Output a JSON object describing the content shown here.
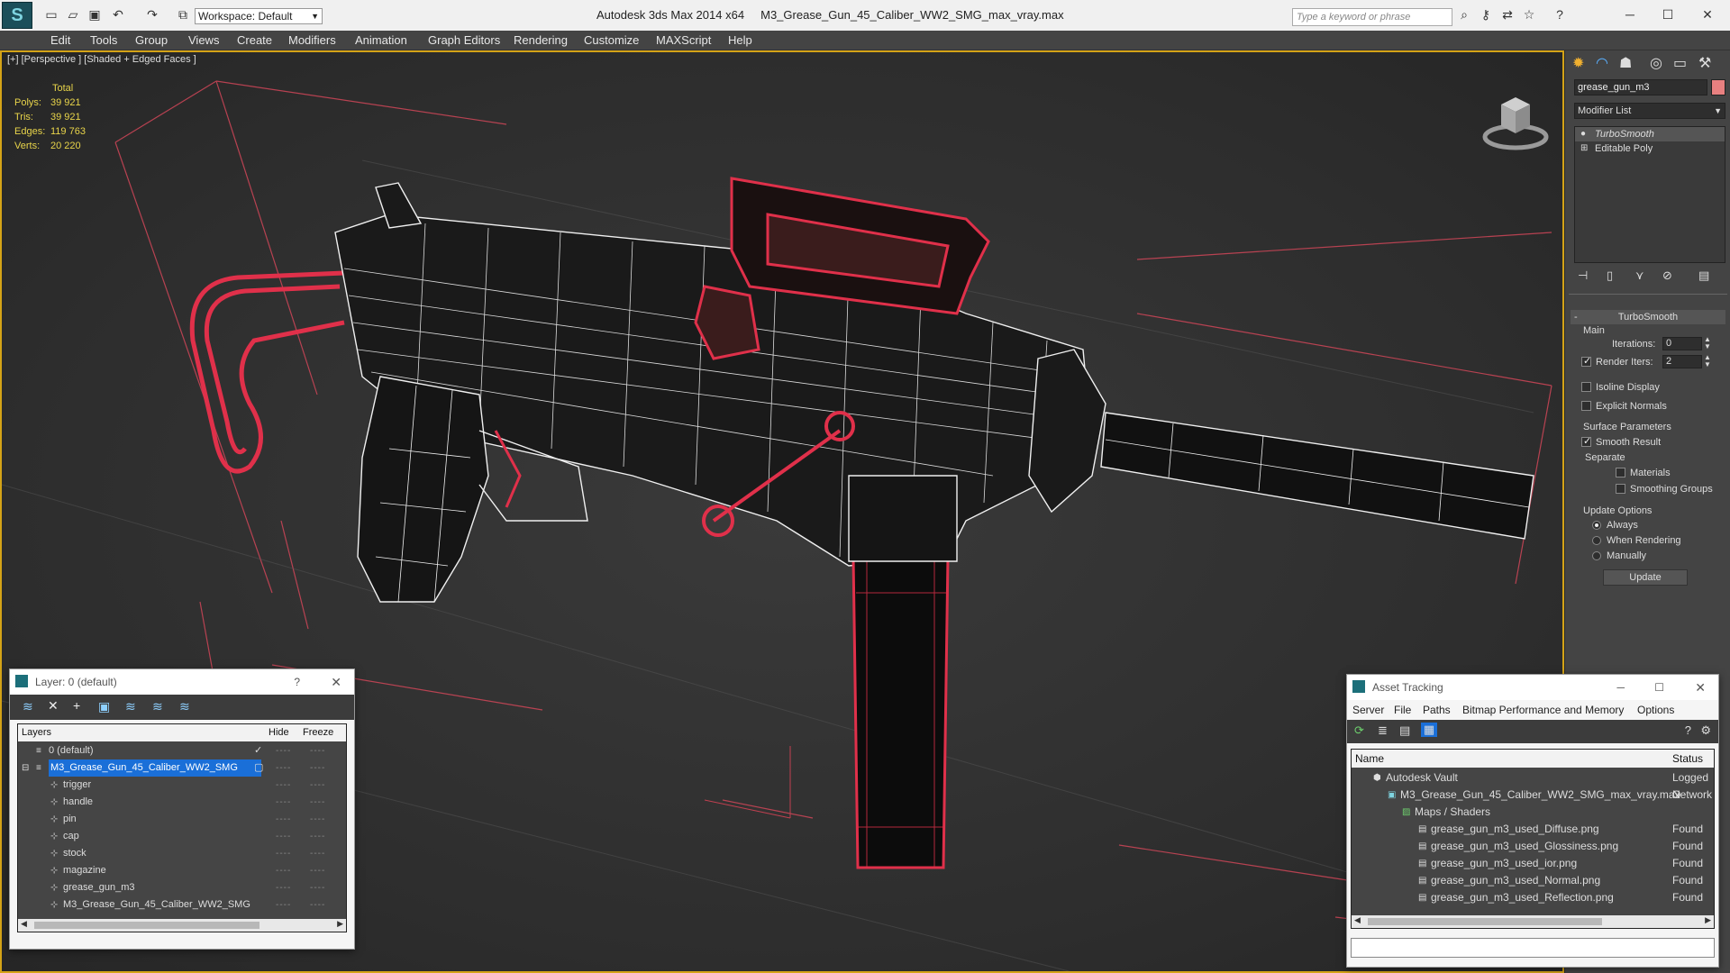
{
  "app": {
    "title": "Autodesk 3ds Max  2014 x64",
    "file": "M3_Grease_Gun_45_Caliber_WW2_SMG_max_vray.max",
    "workspace": "Workspace: Default",
    "search_placeholder": "Type a keyword or phrase"
  },
  "menu": [
    "Edit",
    "Tools",
    "Group",
    "Views",
    "Create",
    "Modifiers",
    "Animation",
    "Graph Editors",
    "Rendering",
    "Customize",
    "MAXScript",
    "Help"
  ],
  "viewport": {
    "label": "[+] [Perspective ] [Shaded + Edged Faces ]",
    "stats": {
      "header": "Total",
      "rows": [
        {
          "label": "Polys:",
          "value": "39 921"
        },
        {
          "label": "Tris:",
          "value": "39 921"
        },
        {
          "label": "Edges:",
          "value": "119 763"
        },
        {
          "label": "Verts:",
          "value": "20 220"
        }
      ]
    }
  },
  "command_panel": {
    "object_name": "grease_gun_m3",
    "modifier_list": "Modifier List",
    "stack": [
      "TurboSmooth",
      "Editable Poly"
    ],
    "rollout_title": "TurboSmooth",
    "main_group": "Main",
    "iterations_label": "Iterations:",
    "iterations_value": "0",
    "render_iters_label": "Render Iters:",
    "render_iters_value": "2",
    "isoline": "Isoline Display",
    "explicit_normals": "Explicit Normals",
    "surface_group": "Surface Parameters",
    "smooth_result": "Smooth Result",
    "separate": "Separate",
    "materials": "Materials",
    "smoothing_groups": "Smoothing Groups",
    "update_group": "Update Options",
    "always": "Always",
    "when_rendering": "When Rendering",
    "manually": "Manually",
    "update_button": "Update"
  },
  "layer_window": {
    "title": "Layer: 0 (default)",
    "help": "?",
    "columns": [
      "Layers",
      "Hide",
      "Freeze"
    ],
    "rows": [
      {
        "name": "0 (default)"
      },
      {
        "name": "M3_Grease_Gun_45_Caliber_WW2_SMG"
      },
      {
        "name": "trigger"
      },
      {
        "name": "handle"
      },
      {
        "name": "pin"
      },
      {
        "name": "cap"
      },
      {
        "name": "stock"
      },
      {
        "name": "magazine"
      },
      {
        "name": "grease_gun_m3"
      },
      {
        "name": "M3_Grease_Gun_45_Caliber_WW2_SMG"
      }
    ]
  },
  "asset_window": {
    "title": "Asset Tracking",
    "menu": [
      "Server",
      "File",
      "Paths",
      "Bitmap Performance and Memory",
      "Options"
    ],
    "columns": [
      "Name",
      "Status"
    ],
    "rows": [
      {
        "name": "Autodesk Vault",
        "status": "Logged O"
      },
      {
        "name": "M3_Grease_Gun_45_Caliber_WW2_SMG_max_vray.max",
        "status": "Network P"
      },
      {
        "name": "Maps / Shaders",
        "status": ""
      },
      {
        "name": "grease_gun_m3_used_Diffuse.png",
        "status": "Found"
      },
      {
        "name": "grease_gun_m3_used_Glossiness.png",
        "status": "Found"
      },
      {
        "name": "grease_gun_m3_used_ior.png",
        "status": "Found"
      },
      {
        "name": "grease_gun_m3_used_Normal.png",
        "status": "Found"
      },
      {
        "name": "grease_gun_m3_used_Reflection.png",
        "status": "Found"
      }
    ]
  },
  "colors": {
    "accent": "#d4a317",
    "selection": "#1a6fd8",
    "wire_white": "#f0f0f0",
    "wire_red": "#e0304a",
    "stats_yellow": "#e8d44a"
  }
}
